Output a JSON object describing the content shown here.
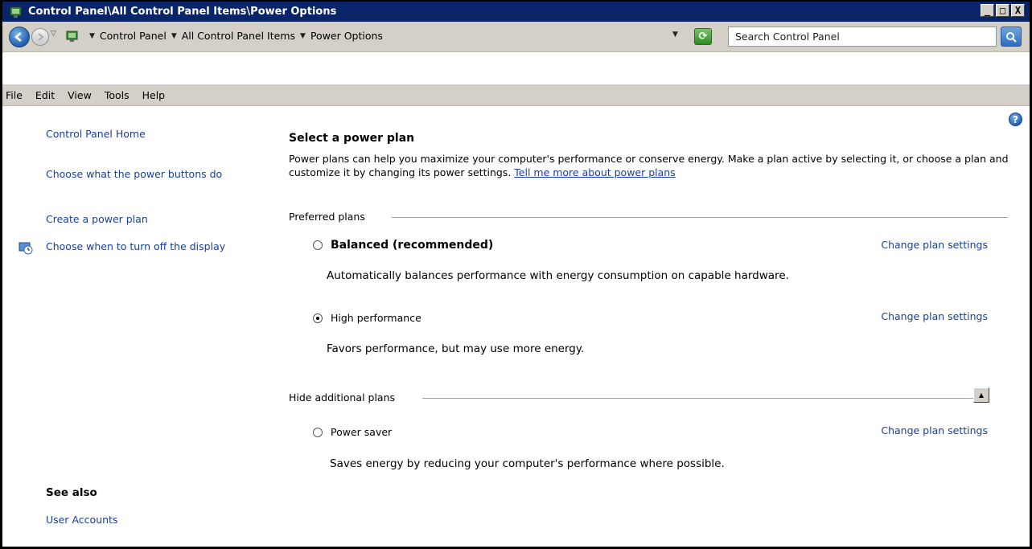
{
  "window": {
    "title": "Control Panel\\All Control Panel Items\\Power Options",
    "controls": [
      "_",
      "□",
      "X"
    ]
  },
  "addressbar": {
    "breadcrumb": [
      "Control Panel",
      "All Control Panel Items",
      "Power Options"
    ],
    "search_placeholder": "Search Control Panel"
  },
  "menu": [
    "File",
    "Edit",
    "View",
    "Tools",
    "Help"
  ],
  "sidebar": {
    "links": [
      "Control Panel Home",
      "Choose what the power buttons do",
      "Create a power plan",
      "Choose when to turn off the display"
    ],
    "see_also_title": "See also",
    "see_also_links": [
      "User Accounts"
    ]
  },
  "main": {
    "title": "Select a power plan",
    "intro": "Power plans can help you maximize your computer's performance or conserve energy. Make a plan active by selecting it, or choose a plan and customize it by changing its power settings. ",
    "intro_link": "Tell me more about power plans",
    "preferred_group": "Preferred plans",
    "additional_group": "Hide additional plans",
    "plans": [
      {
        "name": "Balanced (recommended)",
        "desc": "Automatically balances performance with energy consumption on capable hardware.",
        "link": "Change plan settings",
        "selected": false
      },
      {
        "name": "High performance",
        "desc": "Favors performance, but may use more energy.",
        "link": "Change plan settings",
        "selected": true
      },
      {
        "name": "Power saver",
        "desc": "Saves energy by reducing your computer's performance where possible.",
        "link": "Change plan settings",
        "selected": false
      }
    ]
  },
  "colors": {
    "titlebar": "#0a246a",
    "link": "#1a3e9b",
    "chrome": "#d4d0c8"
  }
}
